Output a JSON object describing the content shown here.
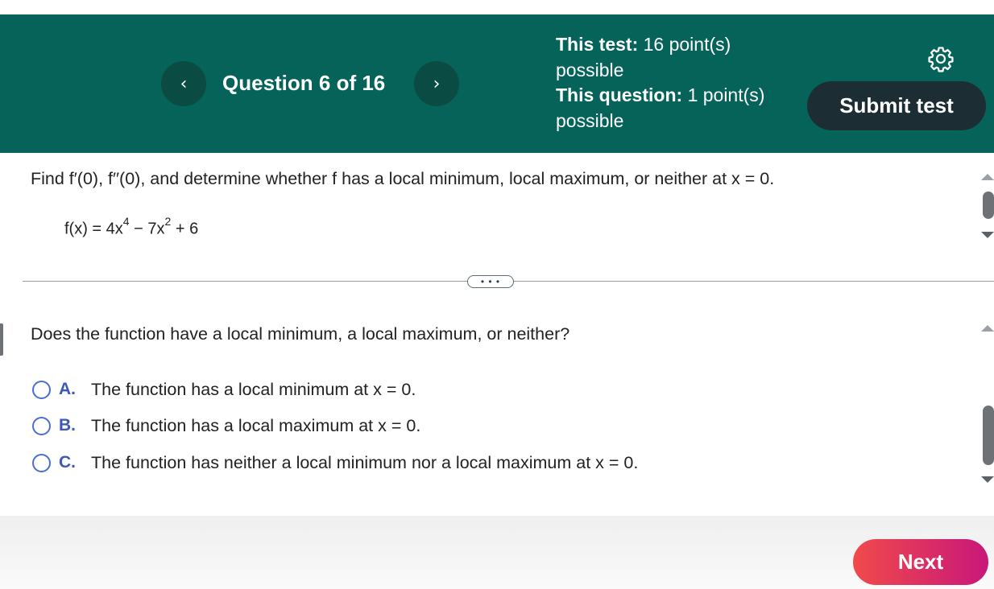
{
  "header": {
    "prev_icon": "‹",
    "next_icon": "›",
    "question_counter": "Question 6 of 16",
    "test_points_label": "This test:",
    "test_points_value": "16 point(s) possible",
    "question_points_label": "This question:",
    "question_points_value": "1 point(s) possible",
    "submit_label": "Submit test",
    "settings_icon": "gear-icon",
    "background_color": "#05635a"
  },
  "problem": {
    "instruction": "Find f′(0), f′′(0), and determine whether f has a local minimum, local maximum, or neither at x = 0.",
    "formula_prefix": "f(x) = 4x",
    "exp1": "4",
    "formula_mid": " − 7x",
    "exp2": "2",
    "formula_suffix": " + 6"
  },
  "expander": {
    "label": "• • •"
  },
  "question": {
    "prompt": "Does the function have a local minimum, a local maximum, or neither?",
    "options": [
      {
        "letter": "A.",
        "text": "The function has a local minimum at x = 0."
      },
      {
        "letter": "B.",
        "text": "The function has a local maximum at x = 0."
      },
      {
        "letter": "C.",
        "text": "The function has neither a local minimum nor a local maximum at x = 0."
      }
    ]
  },
  "footer": {
    "next_label": "Next"
  }
}
